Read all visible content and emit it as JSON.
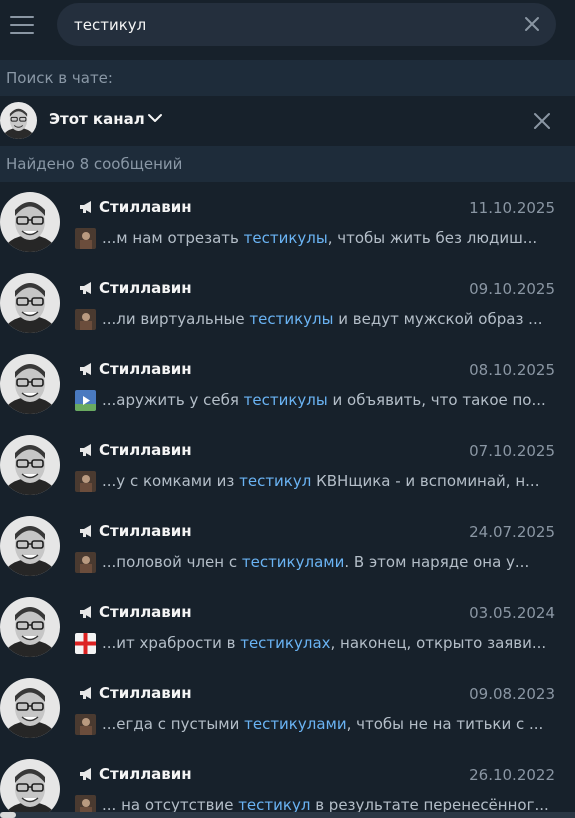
{
  "search": {
    "query": "тестикул",
    "placeholder": ""
  },
  "search_in_chat_label": "Поиск в чате:",
  "scope": {
    "label": "Этот канал"
  },
  "results_count_label": "Найдено 8 сообщений",
  "colors": {
    "background": "#17212b",
    "section_background": "#1e2c3a",
    "highlight": "#6ab3f3",
    "muted_text": "#8a96a3"
  },
  "results": [
    {
      "name": "Стиллавин",
      "date": "11.10.2025",
      "before": "...м нам отрезать ",
      "match": "тестикулы",
      "after": ", чтобы жить без людиш...",
      "thumb": "photo-thumb"
    },
    {
      "name": "Стиллавин",
      "date": "09.10.2025",
      "before": "...ли виртуальные ",
      "match": "тестикулы",
      "after": " и ведут мужской образ ...",
      "thumb": "photo-thumb"
    },
    {
      "name": "Стиллавин",
      "date": "08.10.2025",
      "before": "...аружить у себя ",
      "match": "тестикулы",
      "after": " и объявить, что такое по...",
      "thumb": "video-thumb"
    },
    {
      "name": "Стиллавин",
      "date": "07.10.2025",
      "before": "...у с комками из ",
      "match": "тестикул",
      "after": " КВНщика - и вспоминай, н...",
      "thumb": "photo-thumb"
    },
    {
      "name": "Стиллавин",
      "date": "24.07.2025",
      "before": "...половой член с ",
      "match": "тестикулами",
      "after": ".  В этом наряде она у...",
      "thumb": "photo-thumb"
    },
    {
      "name": "Стиллавин",
      "date": "03.05.2024",
      "before": "...ит храбрости в ",
      "match": "тестикулах",
      "after": ", наконец, открыто заяви...",
      "thumb": "flag-thumb"
    },
    {
      "name": "Стиллавин",
      "date": "09.08.2023",
      "before": "...егда с пустыми ",
      "match": "тестикулами",
      "after": ", чтобы не на титьки с ...",
      "thumb": "photo-thumb"
    },
    {
      "name": "Стиллавин",
      "date": "26.10.2022",
      "before": "... на отсутствие ",
      "match": "тестикул",
      "after": " в результате перенесённог...",
      "thumb": "photo-thumb"
    }
  ]
}
